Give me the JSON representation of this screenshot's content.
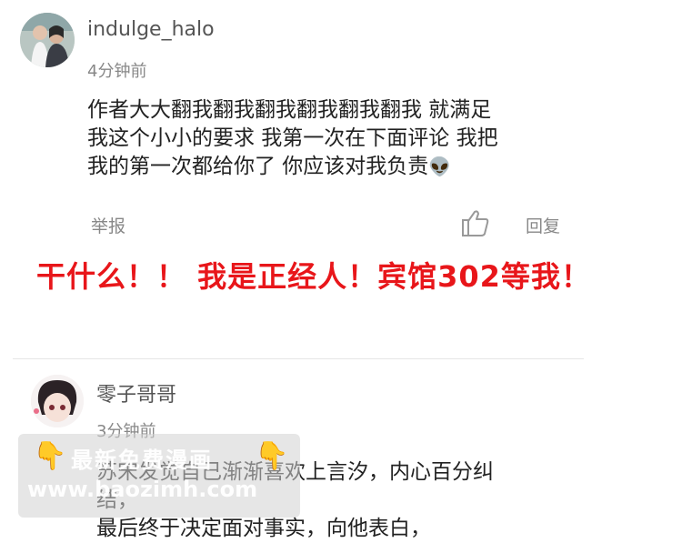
{
  "comments": [
    {
      "username": "indulge_halo",
      "time": "4分钟前",
      "lines": [
        "作者大大翻我翻我翻我翻我翻我翻我 就满足",
        "我这个小小的要求 我第一次在下面评论 我把",
        "我的第一次都给你了 你应该对我负责"
      ],
      "emoji": "👽",
      "report_label": "举报",
      "reply_label": "回复"
    },
    {
      "username": "零子哥哥",
      "time": "3分钟前",
      "lines": [
        "苏宋发觉自己渐渐喜欢上言汐，内心百分纠",
        "结，",
        "最后终于决定面对事实，向他表白，"
      ]
    }
  ],
  "banner_text": "干什么！！ 我是正经人！宾馆302等我！",
  "watermark": {
    "line1": "最新免费漫画",
    "line2": "www.baozimh.com",
    "hand_emoji": "👇"
  },
  "colors": {
    "banner": "#e8161a",
    "muted_text": "#888888",
    "divider": "#e6e6e6"
  }
}
